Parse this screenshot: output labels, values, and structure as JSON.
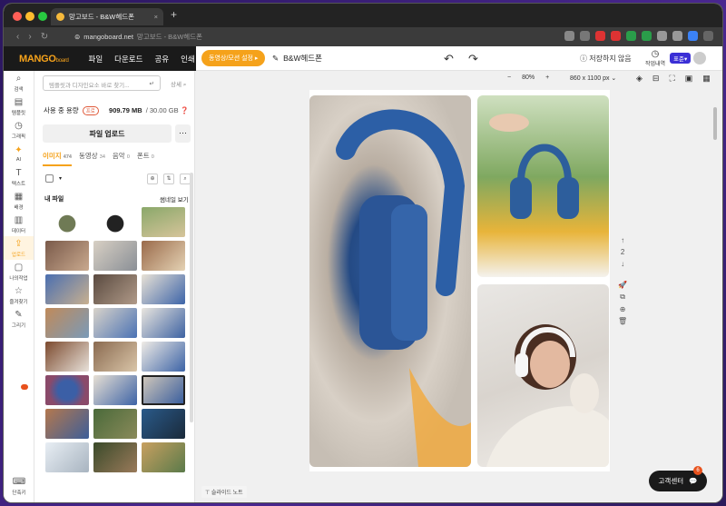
{
  "browser": {
    "tab_title": "망고보드 - B&W헤드폰",
    "url": "mangoboard.net",
    "url_suffix": "망고보드 - B&W헤드폰",
    "new_tab": "+"
  },
  "header": {
    "logo_main": "MANGO",
    "logo_sub": "board",
    "menu": [
      "파일",
      "다운로드",
      "공유",
      "인쇄"
    ],
    "promo": "동영상/모션 설정 ▸",
    "doc_name": "B&W헤드폰",
    "save_status": "저장하지 않음",
    "history_label": "작업내역",
    "lang_badge": "표준▾"
  },
  "rail": {
    "items": [
      {
        "icon": "⌕",
        "label": "검색"
      },
      {
        "icon": "▤",
        "label": "템플릿"
      },
      {
        "icon": "◷",
        "label": "그래픽"
      },
      {
        "icon": "✦",
        "label": "AI"
      },
      {
        "icon": "T",
        "label": "텍스트"
      },
      {
        "icon": "▦",
        "label": "배경"
      },
      {
        "icon": "▥",
        "label": "데이터"
      },
      {
        "icon": "⇪",
        "label": "업로드"
      },
      {
        "icon": "▢",
        "label": "나의작업"
      },
      {
        "icon": "☆",
        "label": "즐겨찾기"
      },
      {
        "icon": "✎",
        "label": "그리기"
      }
    ],
    "shortcut_icon": "⌨",
    "shortcut_label": "단축키"
  },
  "panel": {
    "search_placeholder": "템플릿과 디자인요소 바로 찾기...",
    "search_enter": "↵",
    "advanced": "상세 ⌕",
    "usage_label": "사용 중 용량",
    "usage_badge": "프로",
    "usage_value": "909.79 MB",
    "usage_total": "/ 30.00 GB ❓",
    "upload_button": "파일 업로드",
    "more_button": "⋯",
    "tabs": [
      {
        "label": "이미지",
        "count": "474"
      },
      {
        "label": "동영상",
        "count": "34"
      },
      {
        "label": "음악",
        "count": "0"
      },
      {
        "label": "폰트",
        "count": "0"
      }
    ],
    "folder_icon": "⊕",
    "sort_icon": "⇅",
    "search_icon": "⌕",
    "my_files": "내 파일",
    "thumb_view": "썸네일 보기 ▾"
  },
  "canvas": {
    "zoom_out": "−",
    "zoom_value": "80%",
    "zoom_in": "+",
    "page_size": "860 x 1100 px ⌄",
    "page_up": "↑",
    "page_number": "2",
    "page_down": "↓",
    "slide_note": "⊤ 슬라이드 노트"
  },
  "help": {
    "label": "고객센터",
    "count": "6"
  },
  "colors": {
    "accent": "#f5a21b",
    "dark": "#1a1a1a",
    "badge": "#e8511c"
  }
}
